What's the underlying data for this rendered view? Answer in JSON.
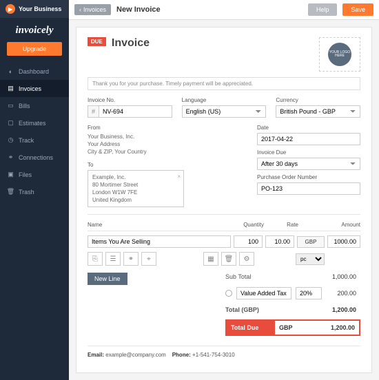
{
  "brand": {
    "business": "Your Business",
    "app": "invoicely",
    "upgrade": "Upgrade"
  },
  "nav": {
    "items": [
      {
        "icon": "dashboard",
        "label": "Dashboard"
      },
      {
        "icon": "invoices",
        "label": "Invoices"
      },
      {
        "icon": "bills",
        "label": "Bills"
      },
      {
        "icon": "estimates",
        "label": "Estimates"
      },
      {
        "icon": "track",
        "label": "Track"
      },
      {
        "icon": "connections",
        "label": "Connections"
      },
      {
        "icon": "files",
        "label": "Files"
      },
      {
        "icon": "trash",
        "label": "Trash"
      }
    ]
  },
  "topbar": {
    "back": "Invoices",
    "title": "New Invoice",
    "help": "Help",
    "save": "Save"
  },
  "inv": {
    "due": "DUE",
    "title": "Invoice",
    "logo_text": "YOUR LOGO HERE",
    "note": "Thank you for your purchase. Timely payment will be appreciated.",
    "no_label": "Invoice No.",
    "no_prefix": "#",
    "no_value": "NV-694",
    "lang_label": "Language",
    "lang_value": "English (US)",
    "cur_label": "Currency",
    "cur_value": "British Pound - GBP",
    "from_label": "From",
    "from_lines": [
      "Your Business, Inc.",
      "Your Address",
      "City & ZIP, Your Country"
    ],
    "to_label": "To",
    "to_lines": [
      "Example, Inc.",
      "80 Mortimer Street",
      "London W1W 7FE",
      "United Kingdom"
    ],
    "date_label": "Date",
    "date_value": "2017-04-22",
    "due_label": "Invoice Due",
    "due_value": "After 30 days",
    "po_label": "Purchase Order Number",
    "po_value": "PO-123",
    "cols": {
      "name": "Name",
      "qty": "Quantity",
      "rate": "Rate",
      "amount": "Amount"
    },
    "line": {
      "name": "Items You Are Selling",
      "qty": "100",
      "rate": "10.00",
      "cur": "GBP",
      "amount": "1000.00",
      "per": "pc"
    },
    "newline": "New Line",
    "totals": {
      "sub_label": "Sub Total",
      "sub": "1,000.00",
      "tax_name": "Value Added Tax",
      "tax_pct": "20%",
      "tax_amt": "200.00",
      "total_label": "Total (GBP)",
      "total": "1,200.00",
      "due_label": "Total Due",
      "due_cur": "GBP",
      "due_amt": "1,200.00"
    },
    "footer": {
      "email_lbl": "Email:",
      "email": "example@company.com",
      "phone_lbl": "Phone:",
      "phone": "+1-541-754-3010"
    }
  }
}
